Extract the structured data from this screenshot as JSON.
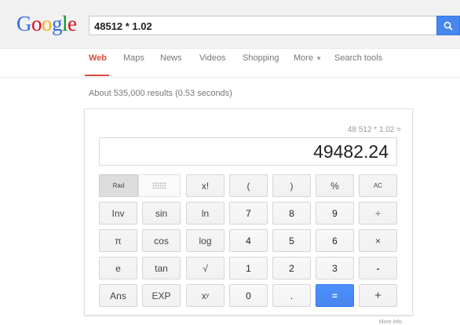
{
  "header": {
    "logo": "Google",
    "query": "48512 * 1.02",
    "search_icon": "magnifier-icon"
  },
  "nav": {
    "tabs": [
      "Web",
      "Maps",
      "News",
      "Videos",
      "Shopping",
      "More",
      "Search tools"
    ],
    "active_tab": "Web"
  },
  "results": {
    "stats": "About 535,000 results (0.53 seconds)"
  },
  "calculator": {
    "expression": "48 512 * 1.02 =",
    "result": "49482.24",
    "rows": [
      [
        "Rad",
        "",
        "x!",
        "(",
        ")",
        "%",
        "AC"
      ],
      [
        "Inv",
        "sin",
        "ln",
        "7",
        "8",
        "9",
        "÷"
      ],
      [
        "π",
        "cos",
        "log",
        "4",
        "5",
        "6",
        "×"
      ],
      [
        "e",
        "tan",
        "√",
        "1",
        "2",
        "3",
        "-"
      ],
      [
        "Ans",
        "EXP",
        "x",
        "0",
        ".",
        "=",
        "+"
      ]
    ],
    "power_sup": "y"
  },
  "footer": {
    "more_info": "More info"
  },
  "colors": {
    "accent_red": "#dd4b39",
    "blue": "#4787ed"
  }
}
